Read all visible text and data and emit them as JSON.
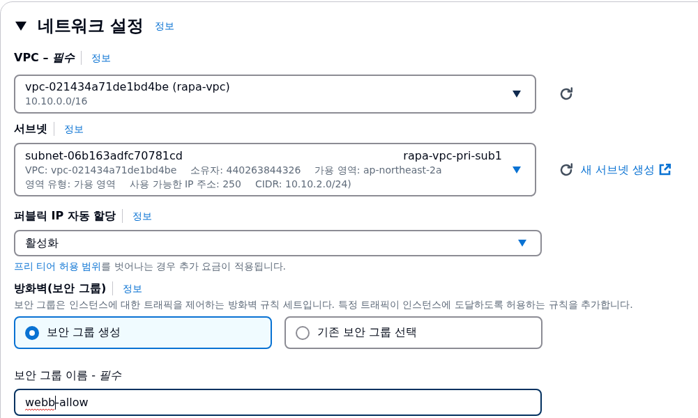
{
  "section": {
    "title": "네트워크 설정",
    "expanded": true,
    "info_link": "정보"
  },
  "vpc": {
    "label": "VPC – *필수*",
    "info_link": "정보",
    "select": {
      "value": "vpc-021434a71de1bd4be (rapa-vpc)",
      "description": "10.10.0.0/16",
      "caret_highlighted": false
    }
  },
  "subnet": {
    "label": "서브넷",
    "info_link": "정보",
    "select": {
      "value": "subnet-06b163adfc70781cd",
      "tag": "rapa-vpc-pri-sub1",
      "details": [
        [
          "VPC: vpc-021434a71de1bd4be",
          "소유자: 440263844326",
          "가용 영역: ap-northeast-2a"
        ],
        [
          "영역 유형: 가용 영역",
          "사용 가능한 IP 주소: 250",
          "CIDR: 10.10.2.0/24)"
        ]
      ],
      "caret_highlighted": true
    },
    "create_link": "새 서브넷 생성"
  },
  "public_ip": {
    "label": "퍼블릭 IP 자동 할당",
    "info_link": "정보",
    "select": {
      "value": "활성화",
      "caret_highlighted": true
    },
    "hint": {
      "link": "프리 티어 허용 범위",
      "text": "를 벗어나는 경우 추가 요금이 적용됩니다."
    }
  },
  "firewall": {
    "label": "방화벽(보안 그룹)",
    "info_link": "정보",
    "description": "보안 그룹은 인스턴스에 대한 트래픽을 제어하는 방화벽 규칙 세트입니다. 특정 트래픽이 인스턴스에 도달하도록 허용하는 규칙을 추가합니다.",
    "options": [
      {
        "label": "보안 그룹 생성",
        "selected": true
      },
      {
        "label": "기존 보안 그룹 선택",
        "selected": false
      }
    ]
  },
  "group_name": {
    "label": "보안 그룹 이름 - *필수*",
    "value": "webb-allow",
    "focused": true
  }
}
